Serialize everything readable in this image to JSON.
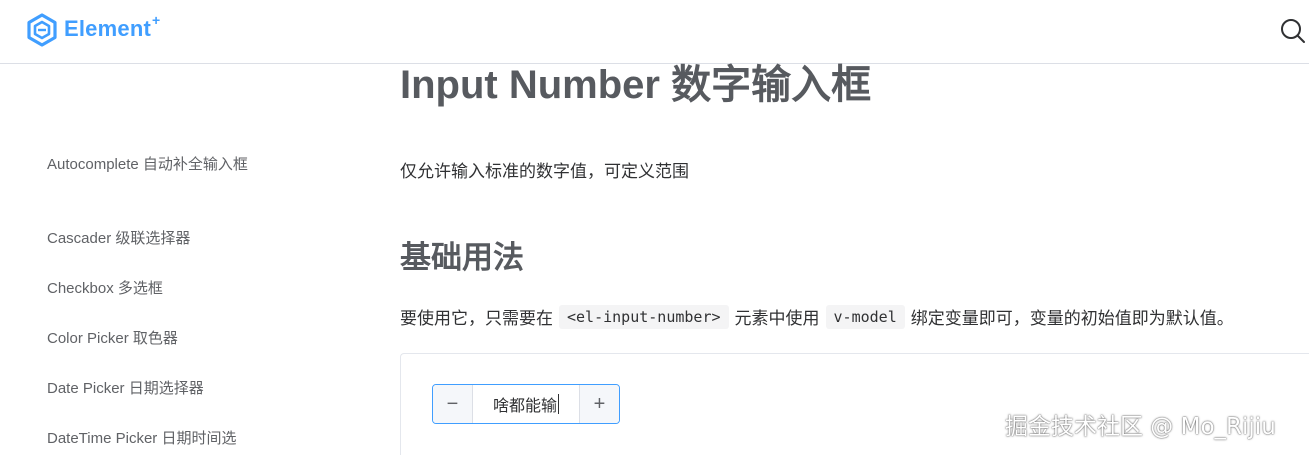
{
  "header": {
    "logo_text": "Element",
    "logo_plus": "+",
    "brand_color": "#409eff",
    "search_icon": "search-icon"
  },
  "sidebar": {
    "items": [
      {
        "label": "Autocomplete 自动补全输入框"
      },
      {
        "label": "Cascader 级联选择器"
      },
      {
        "label": "Checkbox 多选框"
      },
      {
        "label": "Color Picker 取色器"
      },
      {
        "label": "Date Picker 日期选择器"
      },
      {
        "label": "DateTime Picker 日期时间选"
      }
    ]
  },
  "main": {
    "title": "Input Number 数字输入框",
    "description": "仅允许输入标准的数字值，可定义范围",
    "section_title": "基础用法",
    "usage": {
      "part1": "要使用它，只需要在",
      "code1": "<el-input-number>",
      "part2": "元素中使用",
      "code2": "v-model",
      "part3": "绑定变量即可，变量的初始值即为默认值。"
    },
    "demo": {
      "decrease_symbol": "−",
      "increase_symbol": "+",
      "value": "啥都能输"
    }
  },
  "watermark": "掘金技术社区 @ Mo_Rijiu"
}
